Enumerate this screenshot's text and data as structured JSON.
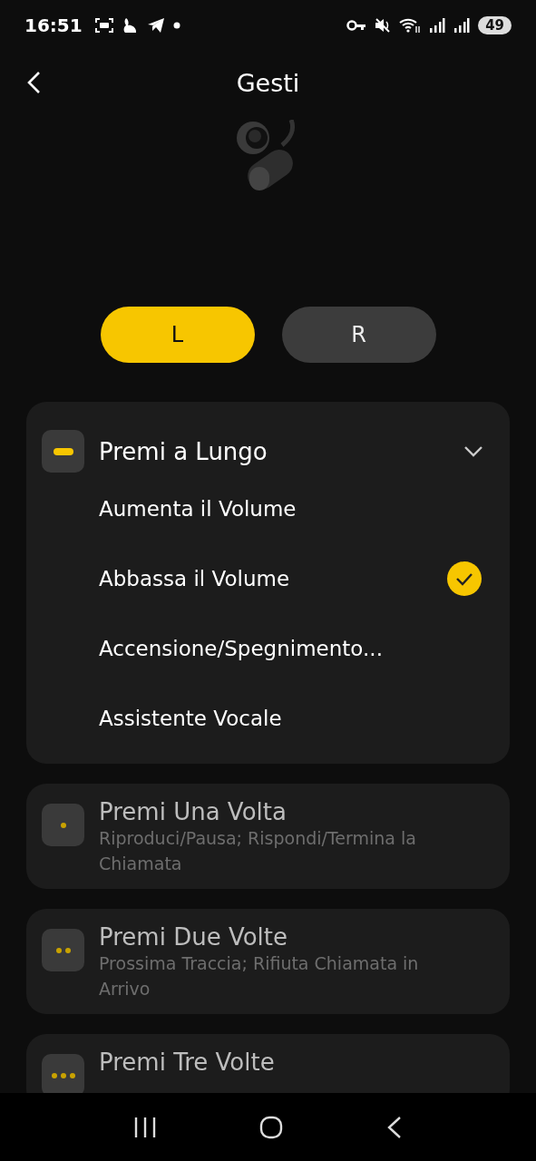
{
  "status_bar": {
    "time": "16:51",
    "battery": "49"
  },
  "header": {
    "title": "Gesti"
  },
  "sides": [
    {
      "label": "L",
      "selected": true
    },
    {
      "label": "R",
      "selected": false
    }
  ],
  "gestures": [
    {
      "kind": "long",
      "title": "Premi a Lungo",
      "expanded": true,
      "options": [
        {
          "label": "Aumenta il Volume",
          "selected": false
        },
        {
          "label": "Abbassa il Volume",
          "selected": true
        },
        {
          "label": "Accensione/Spegnimento...",
          "selected": false
        },
        {
          "label": "Assistente Vocale",
          "selected": false
        }
      ]
    },
    {
      "kind": "single",
      "title": "Premi Una Volta",
      "expanded": false,
      "subtitle": "Riproduci/Pausa; Rispondi/Termina la Chiamata"
    },
    {
      "kind": "double",
      "title": "Premi Due Volte",
      "expanded": false,
      "subtitle": "Prossima Traccia; Rifiuta Chiamata in Arrivo"
    },
    {
      "kind": "triple",
      "title": "Premi Tre Volte",
      "expanded": false
    }
  ]
}
